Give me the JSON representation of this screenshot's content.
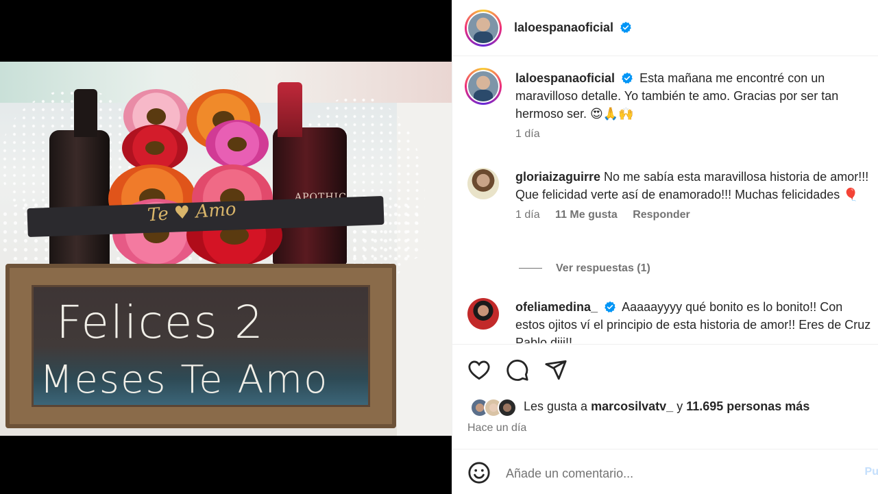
{
  "post": {
    "image_text": {
      "line1": "Felices 2",
      "line2": "Meses Te Amo",
      "ribbon": "Te ♥ Amo"
    }
  },
  "header": {
    "username": "laloespanaoficial",
    "verified": true
  },
  "comments": [
    {
      "username": "laloespanaoficial",
      "verified": true,
      "text": "Esta mañana me encontré con un maravilloso detalle. Yo también te amo. Gracias por ser tan hermoso ser. 😍🙏🙌",
      "time": "1 día"
    },
    {
      "username": "gloriaizaguirre",
      "verified": false,
      "text": "No me sabía esta maravillosa historia de amor!!! Que felicidad verte así de enamorado!!! Muchas felicidades 🎈",
      "time": "1 día",
      "likes": "11 Me gusta",
      "reply": "Responder",
      "view_replies": "Ver respuestas (1)"
    },
    {
      "username": "ofeliamedina_",
      "verified": true,
      "text": "Aaaaayyyy qué bonito es lo bonito!! Con estos ojitos ví el principio de esta historia de amor!! Eres de Cruz Pablo diji!!",
      "time": ""
    }
  ],
  "actions": {
    "like_prefix": "Les gusta a",
    "liked_by": "marcosilvatv_",
    "and": "y",
    "others": "11.695 personas más",
    "posted": "Hace un día"
  },
  "add_comment": {
    "placeholder": "Añade un comentario...",
    "post_label": "Pu"
  },
  "icons": [
    "heart-icon",
    "comment-icon",
    "share-icon",
    "emoji-icon",
    "verified-icon"
  ],
  "colors": {
    "verified": "#0095f6",
    "link_blue": "#c4dffc",
    "muted": "#737373"
  }
}
